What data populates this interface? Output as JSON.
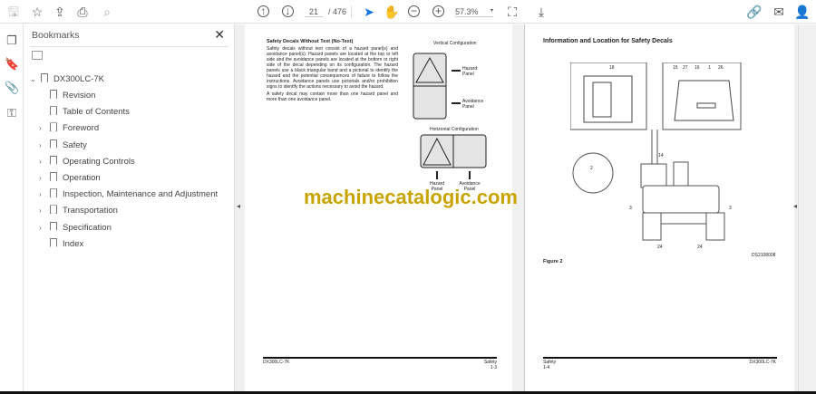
{
  "toolbar": {
    "page_current": "21",
    "page_total": "/ 476",
    "zoom": "57.3%",
    "icons": [
      "save-icon",
      "star-icon",
      "cloud-upload-icon",
      "print-icon",
      "search-icon",
      "page-up-icon",
      "page-down-icon",
      "select-arrow-icon",
      "hand-icon",
      "zoom-out-icon",
      "zoom-in-icon",
      "fit-page-icon",
      "scroll-mode-icon",
      "link-icon",
      "mail-icon",
      "account-icon"
    ]
  },
  "rail": {
    "icons": [
      "pages-icon",
      "bookmark-icon",
      "attachment-icon",
      "accessibility-icon"
    ]
  },
  "bookmarks": {
    "title": "Bookmarks",
    "root": "DX300LC-7K",
    "items": [
      {
        "label": "Revision",
        "expandable": false
      },
      {
        "label": "Table of Contents",
        "expandable": false
      },
      {
        "label": "Foreword",
        "expandable": true
      },
      {
        "label": "Safety",
        "expandable": true
      },
      {
        "label": "Operating Controls",
        "expandable": true
      },
      {
        "label": "Operation",
        "expandable": true
      },
      {
        "label": "Inspection, Maintenance and Adjustment",
        "expandable": true
      },
      {
        "label": "Transportation",
        "expandable": true
      },
      {
        "label": "Specification",
        "expandable": true
      },
      {
        "label": "Index",
        "expandable": false
      }
    ]
  },
  "left_page": {
    "heading": "Safety Decals Without Text (No-Text)",
    "para1": "Safety decals without text consist of a hazard panel(s) and avoidance panel(s). Hazard panels are located at the top or left side and the avoidance panels are located at the bottom or right side of the decal depending on its configuration. The hazard panels use a black triangular band and a pictorial to identify the hazard and the potential consequences of failure to follow the instructions. Avoidance panels use pictorials and/or prohibition signs to identify the actions necessary to avoid the hazard.",
    "para2": "A safety decal may contain more than one hazard panel and more than one avoidance panel.",
    "vertical_label": "Vertical Configuration",
    "horizontal_label": "Horizontal Configuration",
    "hazard_panel": "Hazard Panel",
    "avoidance_panel": "Avoidance Panel",
    "footer_left": "DX300LC-7K",
    "footer_right1": "Safety",
    "footer_right2": "1-3"
  },
  "right_page": {
    "heading": "Information and Location for Safety Decals",
    "callouts": [
      "18",
      "15",
      "27",
      "16",
      "1",
      "26",
      "14",
      "2",
      "3",
      "3",
      "24",
      "24"
    ],
    "figure_code": "DS2108008",
    "figure_caption": "Figure 2",
    "footer_left1": "Safety",
    "footer_left2": "1-4",
    "footer_right": "DX300LC-7K"
  },
  "watermark": "machinecatalogic.com",
  "colors": {
    "accent": "#1473e6",
    "watermark": "#c9a400"
  }
}
